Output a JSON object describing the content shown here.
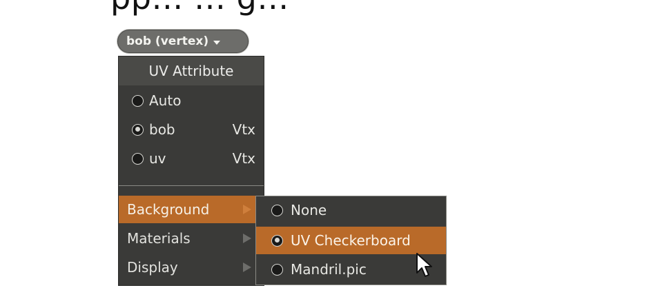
{
  "top_caption": "pp…  …  g…",
  "attribute_button": {
    "label": "bob (vertex)"
  },
  "menu": {
    "header": "UV Attribute",
    "uv_options": [
      {
        "label": "Auto",
        "tag": "",
        "selected": false
      },
      {
        "label": "bob",
        "tag": "Vtx",
        "selected": true
      },
      {
        "label": "uv",
        "tag": "Vtx",
        "selected": false
      }
    ],
    "submenus": [
      {
        "label": "Background",
        "active": true
      },
      {
        "label": "Materials",
        "active": false
      },
      {
        "label": "Display",
        "active": false
      }
    ]
  },
  "background_submenu": {
    "options": [
      {
        "label": "None",
        "selected": false,
        "highlighted": false
      },
      {
        "label": "UV Checkerboard",
        "selected": true,
        "highlighted": true
      },
      {
        "label": "Mandril.pic",
        "selected": false,
        "highlighted": false
      }
    ]
  },
  "colors": {
    "menu_bg": "#3a3a38",
    "highlight": "#b96a29",
    "pill_bg": "#6d6d6a"
  },
  "icons": {
    "cursor": "arrow-cursor-icon",
    "caret": "caret-down-icon",
    "submenu_arrow": "chevron-right-icon"
  }
}
